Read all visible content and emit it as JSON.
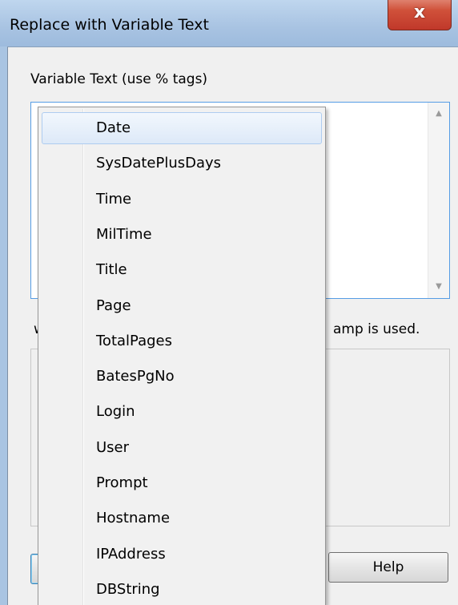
{
  "window": {
    "title": "Replace with Variable Text",
    "close_symbol": "x"
  },
  "form": {
    "variable_label": "Variable Text (use % tags)",
    "textarea_value": "",
    "note_lead": "w",
    "note_trail": "amp is used.",
    "ok_button_visible_fragment": "",
    "help_button": "Help"
  },
  "dropdown": {
    "items": [
      {
        "label": "Date"
      },
      {
        "label": "SysDatePlusDays"
      },
      {
        "label": "Time"
      },
      {
        "label": "MilTime"
      },
      {
        "label": "Title"
      },
      {
        "label": "Page"
      },
      {
        "label": "TotalPages"
      },
      {
        "label": "BatesPgNo"
      },
      {
        "label": "Login"
      },
      {
        "label": "User"
      },
      {
        "label": "Prompt"
      },
      {
        "label": "Hostname"
      },
      {
        "label": "IPAddress"
      },
      {
        "label": "DBString"
      }
    ],
    "highlighted_label": "Date"
  },
  "icons": {
    "scroll_up": "▲",
    "scroll_down": "▼"
  },
  "colors": {
    "title_bar": "#a8c3e2",
    "close_button": "#c9452f",
    "focus_border": "#569de5",
    "highlight": "#dde9f8"
  }
}
